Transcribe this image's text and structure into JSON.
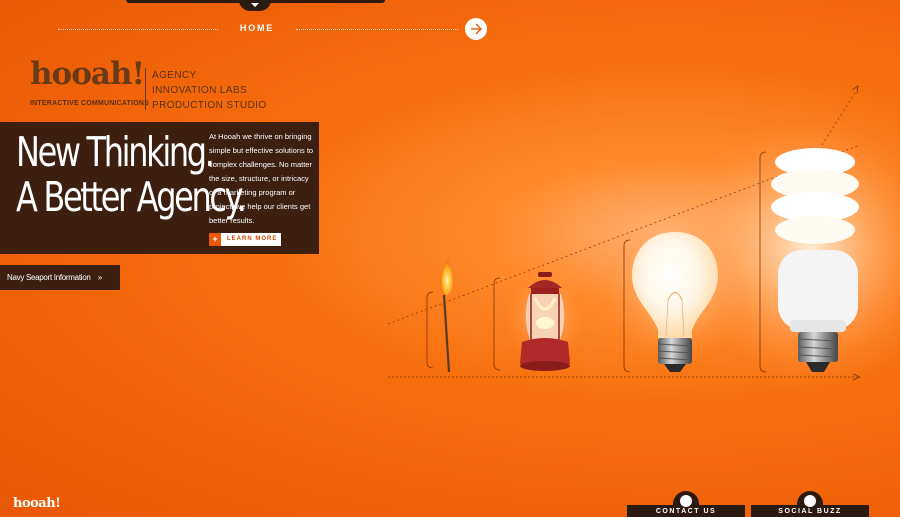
{
  "nav": {
    "home_label": "HOME"
  },
  "brand": {
    "logo_text": "hooah!",
    "tagline": "INTERACTIVE COMMUNICATIONS"
  },
  "services": [
    "AGENCY",
    "INNOVATION LABS",
    "PRODUCTION STUDIO"
  ],
  "hero": {
    "title_line1": "New Thinking.",
    "title_line2": "A Better Agency.",
    "description": "At Hooah we thrive on bringing simple but effective solutions to complex challenges. No matter the size, structure, or intricacy of a marketing program or project, we help our clients get better results.",
    "learn_more_label": "LEARN MORE"
  },
  "navy_link": {
    "label": "Navy Seaport Information",
    "arrow": "»"
  },
  "footer": {
    "logo_text": "hooah!",
    "contact_label": "CONTACT US",
    "social_label": "SOCIAL BUZZ"
  },
  "colors": {
    "background": "#f06209",
    "panel": "#3d1f10",
    "brown_text": "#5a3216",
    "white": "#ffffff"
  },
  "icons": [
    "chevron-down-icon",
    "arrow-right-icon",
    "plus-icon",
    "contact-icon",
    "social-icon"
  ]
}
